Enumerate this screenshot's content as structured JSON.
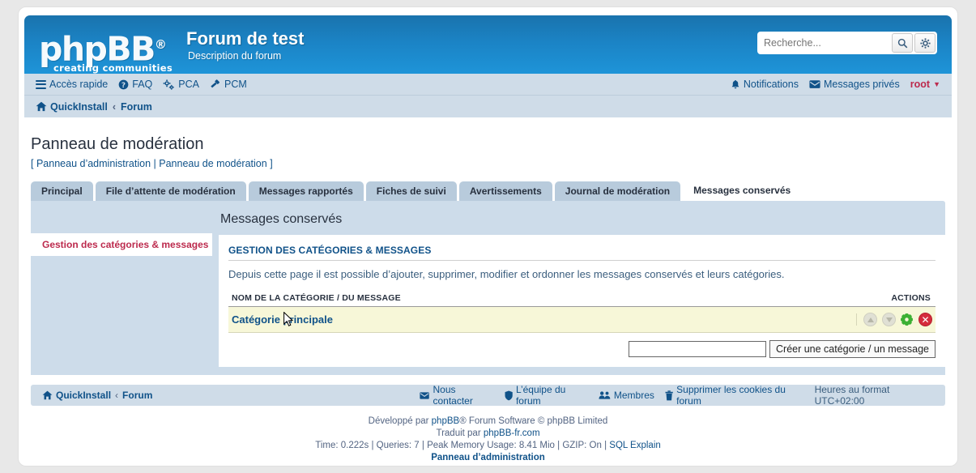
{
  "header": {
    "logo_text": "phpBB",
    "logo_reg": "®",
    "logo_tagline": "creating  communities",
    "site_title": "Forum de test",
    "site_description": "Description du forum",
    "search_placeholder": "Recherche...",
    "search_value": "",
    "search_button_icon": "search-icon",
    "search_options_icon": "gear-icon"
  },
  "nav": {
    "quick_access": "Accès rapide",
    "faq": "FAQ",
    "pca": "PCA",
    "pcm": "PCM",
    "notifications": "Notifications",
    "private_messages": "Messages privés",
    "username": "root",
    "breadcrumb_home": "QuickInstall",
    "breadcrumb_sep": "‹",
    "breadcrumb_forum": "Forum"
  },
  "page": {
    "title": "Panneau de modération",
    "sub_open": "[",
    "sub_admin": "Panneau d’administration",
    "sub_pipe": "|",
    "sub_mod": "Panneau de modération",
    "sub_close": "]"
  },
  "tabs": [
    {
      "label": "Principal",
      "active": false
    },
    {
      "label": "File d’attente de modération",
      "active": false
    },
    {
      "label": "Messages rapportés",
      "active": false
    },
    {
      "label": "Fiches de suivi",
      "active": false
    },
    {
      "label": "Avertissements",
      "active": false
    },
    {
      "label": "Journal de modération",
      "active": false
    },
    {
      "label": "Messages conservés",
      "active": true
    }
  ],
  "sidebar": {
    "items": [
      {
        "label": "Gestion des catégories & messages",
        "active": true
      }
    ]
  },
  "main": {
    "heading": "Messages conservés",
    "box_title": "GESTION DES CATÉGORIES & MESSAGES",
    "box_description": "Depuis cette page il est possible d’ajouter, supprimer, modifier et ordonner les messages conservés et leurs catégories.",
    "table": {
      "columns": [
        "NOM DE LA CATÉGORIE / DU MESSAGE",
        "ACTIONS"
      ],
      "rows": [
        {
          "name": "Catégorie principale",
          "actions": [
            "move-up-icon",
            "move-down-icon",
            "settings-gear-icon",
            "delete-icon"
          ]
        }
      ]
    },
    "form": {
      "input_value": "",
      "input_placeholder": "",
      "submit_label": "Créer une catégorie / un message"
    }
  },
  "footer": {
    "breadcrumb_home": "QuickInstall",
    "breadcrumb_sep": "‹",
    "breadcrumb_forum": "Forum",
    "contact": "Nous contacter",
    "team": "L’équipe du forum",
    "members": "Membres",
    "delete_cookies": "Supprimer les cookies du forum",
    "timezone": "Heures au format UTC+02:00",
    "credit_prefix": "Développé par ",
    "credit_link": "phpBB",
    "credit_suffix": "® Forum Software © phpBB Limited",
    "translated_prefix": "Traduit par ",
    "translated_link": "phpBB-fr.com",
    "stats": "Time: 0.222s | Queries: 7 | Peak Memory Usage: 8.41 Mio | GZIP: On | ",
    "sql_explain": "SQL Explain",
    "admin_link": "Panneau d’administration"
  },
  "colors": {
    "header_blue": "#1b84c6",
    "nav_blue": "#cfdce8",
    "panel_blue": "#cddcea",
    "link_blue": "#105289",
    "accent_red": "#bc2a4d",
    "row_yellow": "#f7f7d8",
    "delete_red": "#d52b3c",
    "gear_green": "#3cb034"
  }
}
